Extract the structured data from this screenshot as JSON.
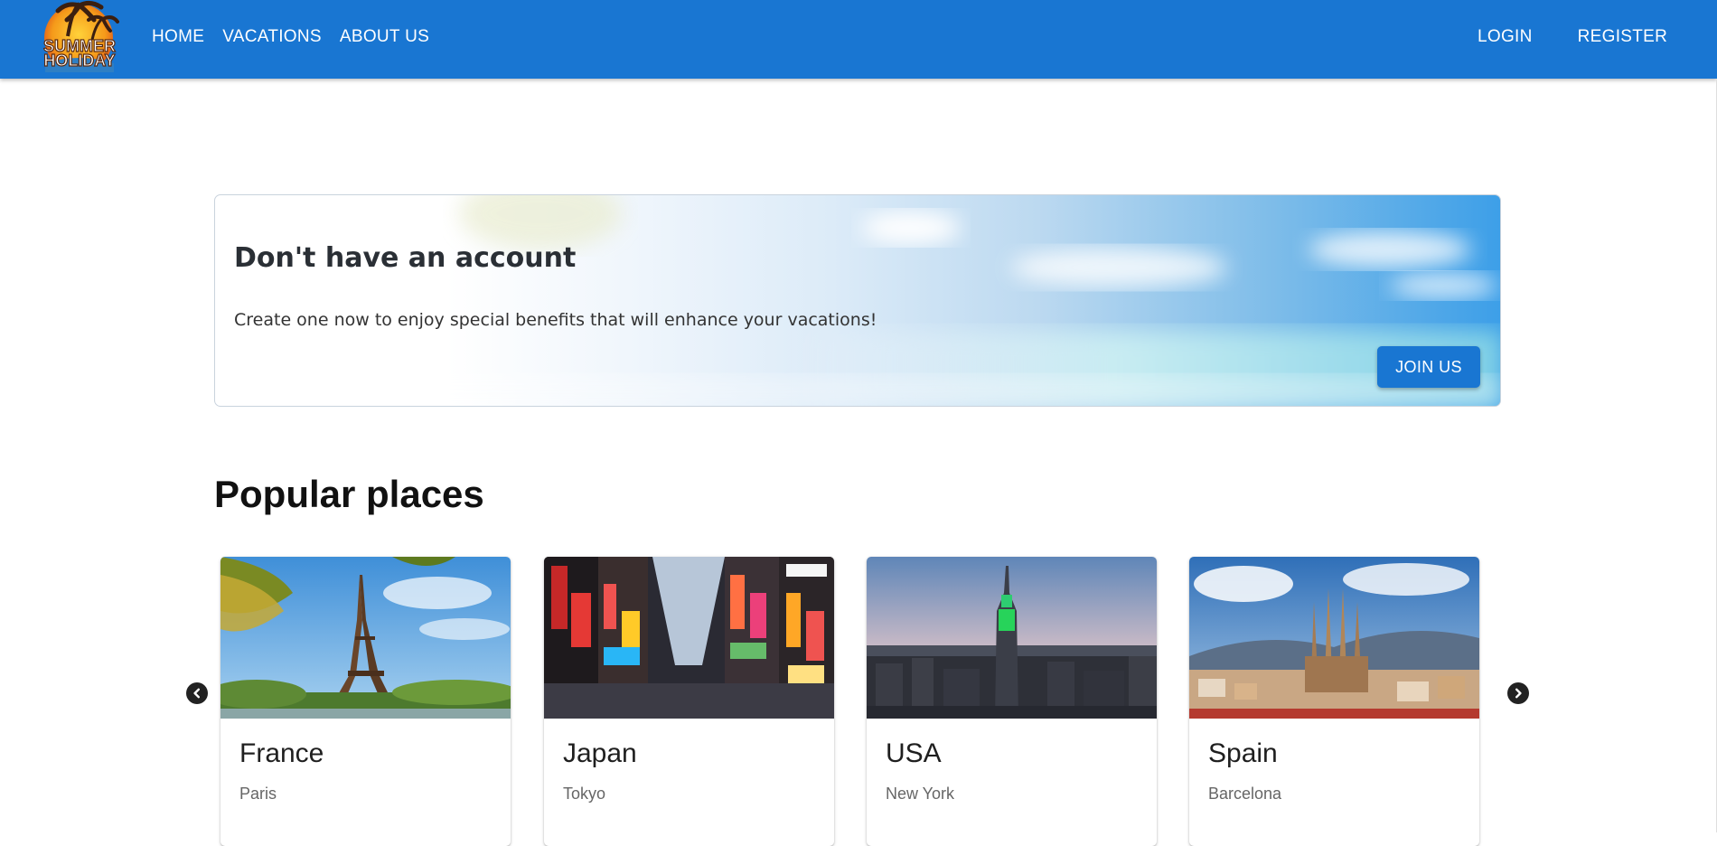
{
  "header": {
    "logo_text": [
      "SUMMER",
      "HOLIDAY"
    ],
    "nav_left": [
      "HOME",
      "VACATIONS",
      "ABOUT US"
    ],
    "nav_right": {
      "login": "LOGIN",
      "register": "REGISTER"
    },
    "colors": {
      "appbar": "#1976d2"
    }
  },
  "banner": {
    "title": "Don't have an account",
    "text": "Create one now to enjoy special benefits that will enhance your vacations!",
    "button_label": "JOIN US"
  },
  "popular": {
    "title": "Popular places",
    "prev_icon": "chevron-left-icon",
    "next_icon": "chevron-right-icon",
    "cards": [
      {
        "country": "France",
        "city": "Paris",
        "image": "eiffel-tower"
      },
      {
        "country": "Japan",
        "city": "Tokyo",
        "image": "tokyo-street"
      },
      {
        "country": "USA",
        "city": "New York",
        "image": "new-york-skyline"
      },
      {
        "country": "Spain",
        "city": "Barcelona",
        "image": "sagrada-familia"
      }
    ]
  }
}
